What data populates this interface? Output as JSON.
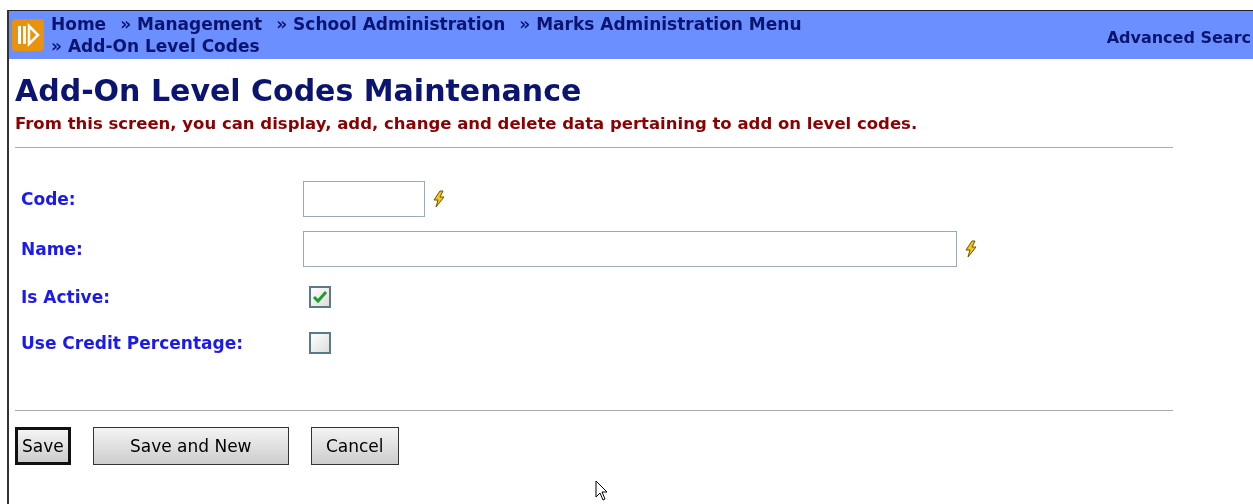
{
  "breadcrumb": {
    "items": [
      {
        "label": "Home"
      },
      {
        "label": "Management",
        "separator": "»"
      },
      {
        "label": "School Administration",
        "separator": "»"
      },
      {
        "label": "Marks Administration Menu",
        "separator": "»"
      },
      {
        "label": "Add-On Level Codes",
        "separator": "»"
      }
    ],
    "advanced_search": "Advanced Searc"
  },
  "title": "Add-On Level Codes Maintenance",
  "description": "From this screen, you can display, add, change and delete data pertaining to add on level codes.",
  "fields": [
    {
      "kind": "text",
      "label": "Code:"
    },
    {
      "kind": "text",
      "label": "Name:"
    },
    {
      "kind": "checkbox",
      "label": "Is Active:",
      "checked": true
    },
    {
      "kind": "checkbox",
      "label": "Use Credit Percentage:",
      "checked": false
    }
  ],
  "buttons": [
    {
      "label": "Save",
      "default": true
    },
    {
      "label": "Save and New",
      "default": false
    },
    {
      "label": "Cancel",
      "default": false
    }
  ]
}
